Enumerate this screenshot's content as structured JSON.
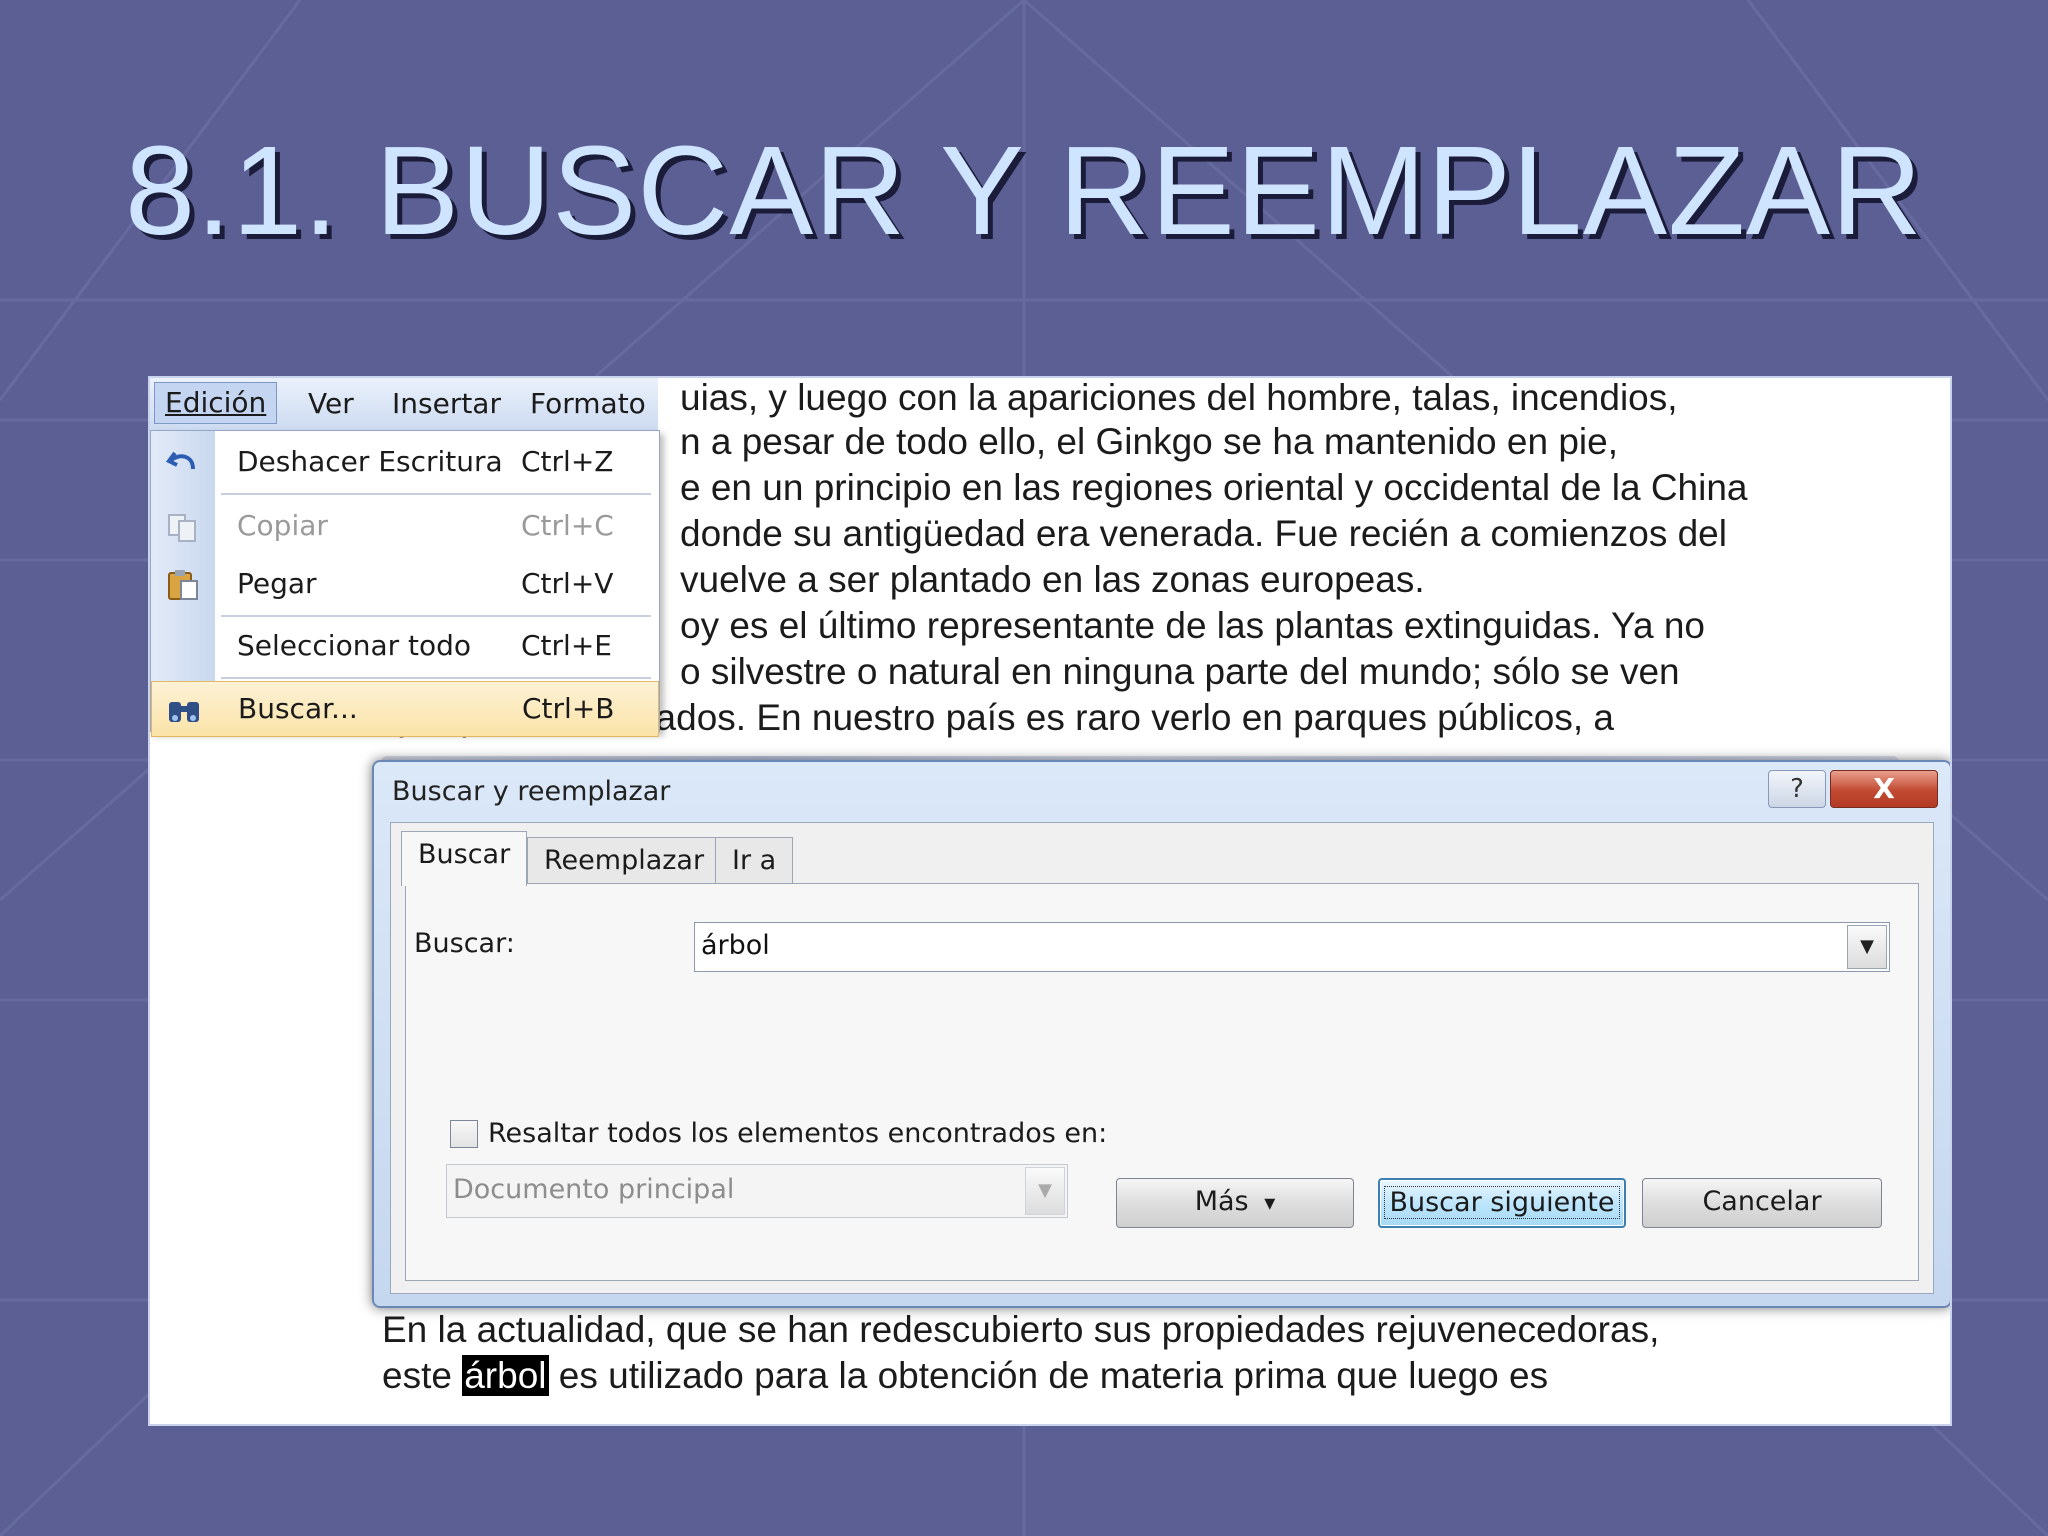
{
  "slide": {
    "title": "8.1. BUSCAR Y REEMPLAZAR"
  },
  "document": {
    "lines_top": [
      "uias, y luego con la apariciones del  hombre, talas, incendios,",
      "n a pesar de todo ello, el  Ginkgo se ha mantenido en pie,",
      "e en un principio en las regiones oriental y occidental de la China",
      "donde su antigüedad era venerada. Fue recién a comienzos del",
      "vuelve a ser plantado en las zonas europeas.",
      "oy es el último representante de las plantas extinguidas. Ya no",
      "o silvestre o natural en ninguna parte del mundo; sólo se ven",
      "ejemplares cultivados. En nuestro país es raro verlo en parques públicos, a"
    ],
    "line_bottom_1": "En la actualidad, que se han redescubierto sus propiedades rejuvenecedoras,",
    "line_bottom_2_pre": "este ",
    "line_bottom_2_highlight": "árbol",
    "line_bottom_2_post": " es utilizado para la obtención de materia prima que luego es"
  },
  "menubar": {
    "items": [
      "Edición",
      "Ver",
      "Insertar",
      "Formato"
    ]
  },
  "edit_menu": {
    "items": [
      {
        "label": "Deshacer Escritura",
        "shortcut": "Ctrl+Z",
        "icon": "undo-icon"
      },
      {
        "label": "Copiar",
        "shortcut": "Ctrl+C",
        "icon": "copy-icon",
        "disabled": true
      },
      {
        "label": "Pegar",
        "shortcut": "Ctrl+V",
        "icon": "paste-icon"
      },
      {
        "label": "Seleccionar todo",
        "shortcut": "Ctrl+E"
      },
      {
        "label": "Buscar...",
        "shortcut": "Ctrl+B",
        "icon": "binoculars-icon",
        "selected": true
      }
    ]
  },
  "dialog": {
    "title": "Buscar y reemplazar",
    "help_label": "?",
    "close_label": "X",
    "tabs": [
      "Buscar",
      "Reemplazar",
      "Ir a"
    ],
    "active_tab": "Buscar",
    "find_label": "Buscar:",
    "find_value": "árbol",
    "highlight_label": "Resaltar todos los elementos encontrados en:",
    "highlight_checked": false,
    "scope_value": "Documento principal",
    "buttons": {
      "more": "Más",
      "more_arrow": "¥",
      "find_next": "Buscar siguiente",
      "cancel": "Cancelar"
    }
  },
  "colors": {
    "slide_background": "#5b5f93",
    "title_text": "#cfe4ff",
    "menu_selected": "#fbe3a8",
    "close_button": "#c24a32",
    "default_button": "#bee6fd"
  }
}
